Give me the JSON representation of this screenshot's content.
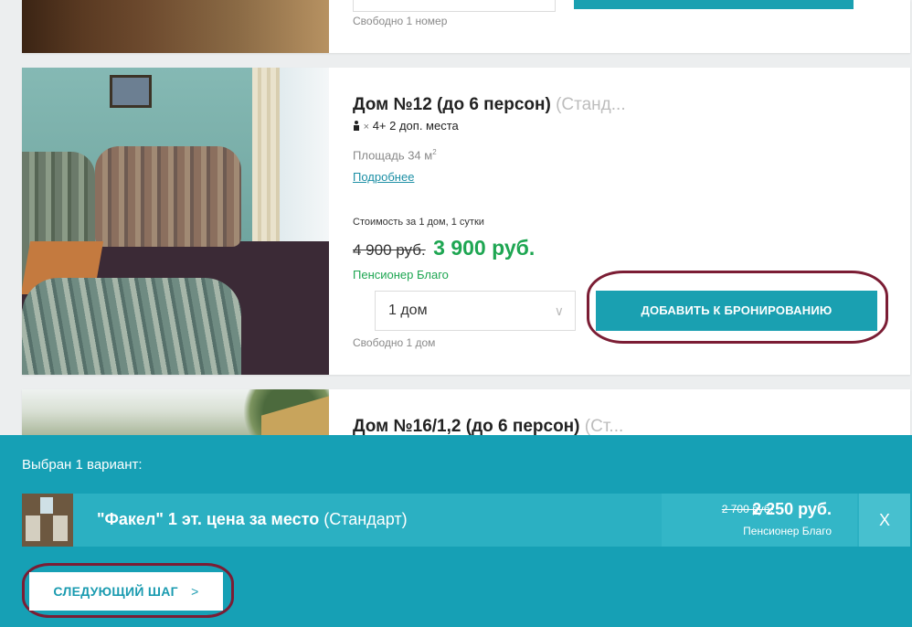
{
  "card_prev": {
    "availability": "Свободно 1 номер"
  },
  "card_main": {
    "title": "Дом №12 (до 6 персон)",
    "category": "(Станд...",
    "guests": "4+ 2 доп. места",
    "guests_mult": "×",
    "area": "Площадь 34 м",
    "area_unit_sup": "2",
    "more_link": "Подробнее",
    "cost_label": "Стоимость за 1 дом, 1 сутки",
    "old_price": "4 900 руб.",
    "new_price": "3 900 руб.",
    "tariff": "Пенсионер Благо",
    "quantity_value": "1 дом",
    "add_button": "ДОБАВИТЬ К БРОНИРОВАНИЮ",
    "availability": "Свободно 1 дом"
  },
  "card_next": {
    "title": "Дом №16/1,2 (до 6 персон)",
    "category": "(Ст..."
  },
  "selection_bar": {
    "heading": "Выбран 1 вариант:",
    "item": {
      "name_bold": "\"Факел\" 1 эт. цена за место",
      "category": "(Стандарт)",
      "old_price": "2 700 руб.",
      "new_price": "2 250 руб.",
      "tariff": "Пенсионер Благо",
      "remove": "X"
    },
    "next_button": "СЛЕДУЮЩИЙ ШАГ",
    "next_chevron": ">"
  },
  "colors": {
    "accent": "#1aa0b1",
    "price_green": "#1ea652",
    "highlight_ring": "#7b1d34",
    "bar_bg": "#16a0b5"
  }
}
